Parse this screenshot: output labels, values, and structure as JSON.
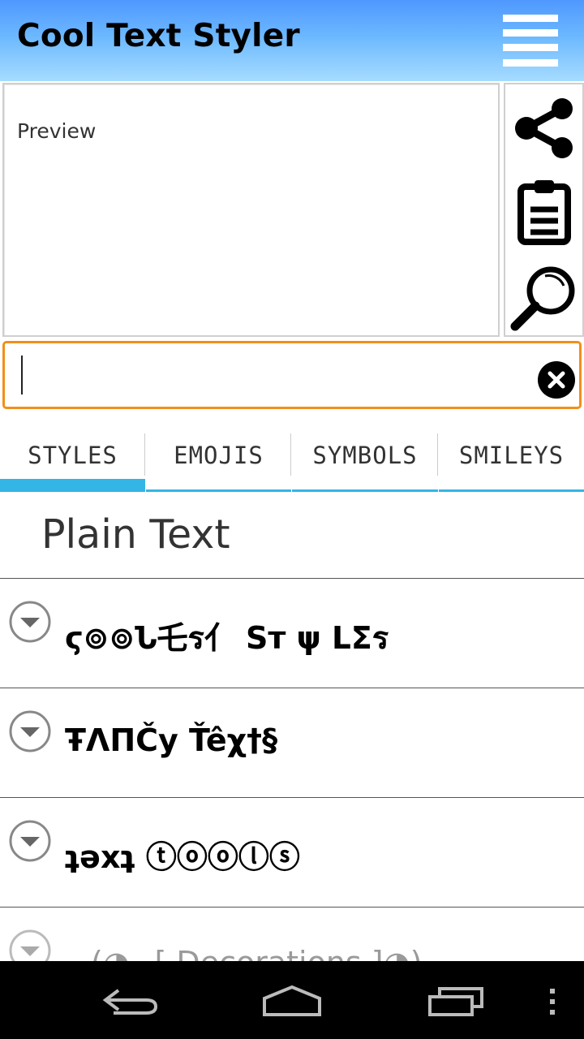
{
  "app": {
    "title": "Cool Text Styler",
    "accent_color": "#f0901a",
    "tab_indicator_color": "#33b5e5",
    "header_gradient": [
      "#4f98ff",
      "#a6dcff"
    ]
  },
  "preview": {
    "placeholder": "Preview"
  },
  "actions": {
    "share_icon": "share-icon",
    "clipboard_icon": "clipboard-icon",
    "search_icon": "search-icon"
  },
  "input": {
    "value": "",
    "clear_icon": "close-icon"
  },
  "tabs": [
    {
      "label": "STYLES",
      "active": true
    },
    {
      "label": "EMOJIS",
      "active": false
    },
    {
      "label": "SYMBOLS",
      "active": false
    },
    {
      "label": "SMILEYS",
      "active": false
    }
  ],
  "list": {
    "header": "Plain Text",
    "items": [
      {
        "text": "ϛ⊚⊚Ն乇ร亻 Sт ψ ᒪΣร"
      },
      {
        "text": "ŦΛПČy Ťêχ†§"
      },
      {
        "text": "ʇǝxʇ ⓣⓞⓞⓛⓢ"
      },
      {
        "text": "(◕‿[ Decorations ]◕)"
      }
    ]
  },
  "system_nav": {
    "back_icon": "back-icon",
    "home_icon": "home-icon",
    "recents_icon": "recents-icon",
    "overflow_icon": "overflow-menu-icon"
  }
}
